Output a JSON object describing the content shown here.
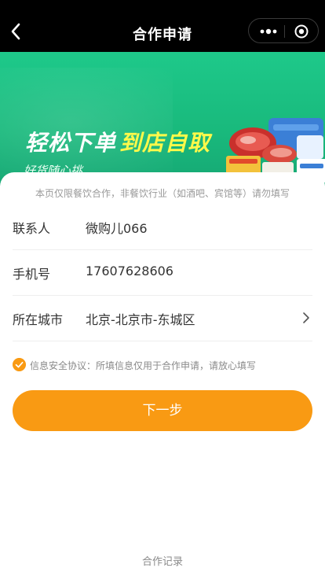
{
  "nav": {
    "title": "合作申请",
    "icons": [
      "back-arrow-icon",
      "more-dots-icon",
      "close-circle-icon"
    ]
  },
  "banner": {
    "slogan_white": "轻松下单",
    "slogan_yellow": "到店自取",
    "slogan_sub": "好货随心挑"
  },
  "form": {
    "notice": "本页仅限餐饮合作，非餐饮行业（如酒吧、宾馆等）请勿填写",
    "contact": {
      "label": "联系人",
      "value": "微购儿066"
    },
    "phone": {
      "label": "手机号",
      "value": "17607628606"
    },
    "city": {
      "label": "所在城市",
      "value": "北京-北京市-东城区"
    },
    "agreement": "信息安全协议：所填信息仅用于合作申请，请放心填写",
    "agreement_checked": true,
    "next_button": "下一步"
  },
  "footer": {
    "records_link": "合作记录"
  },
  "colors": {
    "accent": "#f99a13",
    "banner": "#1ec98a",
    "slogan_yellow": "#fff94a"
  }
}
